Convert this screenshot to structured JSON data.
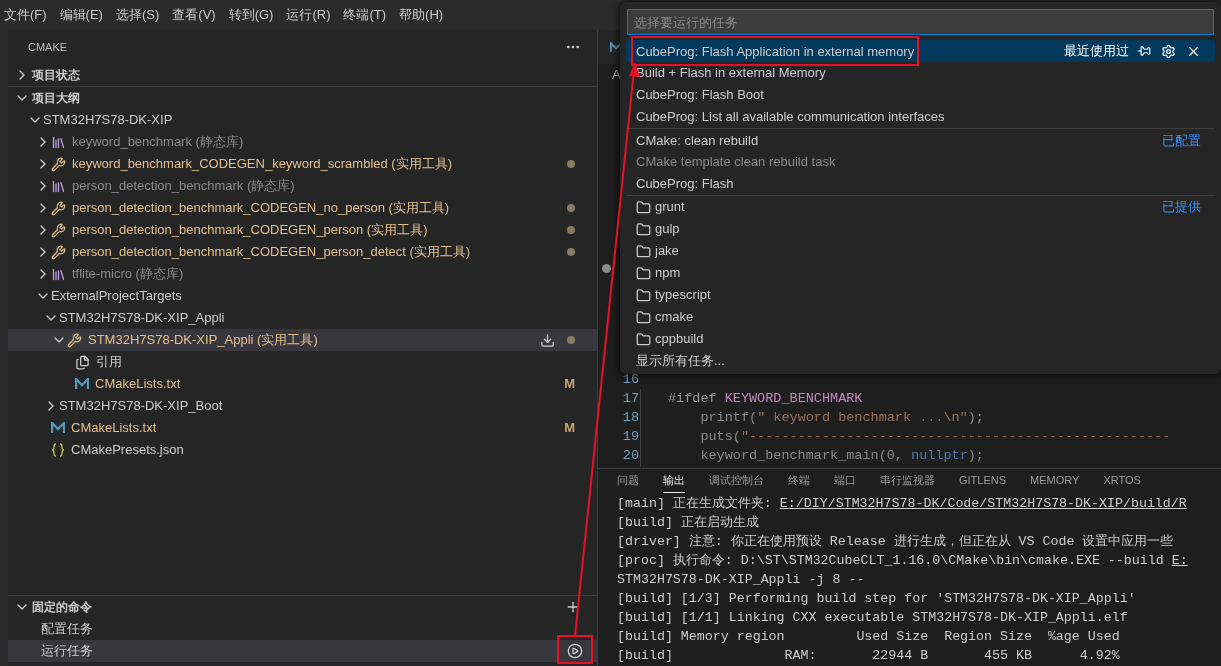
{
  "menu_bar": [
    "文件(F)",
    "编辑(E)",
    "选择(S)",
    "查看(V)",
    "转到(G)",
    "运行(R)",
    "终端(T)",
    "帮助(H)"
  ],
  "sidebar": {
    "title": "CMAKE",
    "sections": [
      {
        "label": "项目状态",
        "expanded": false
      },
      {
        "label": "项目大纲",
        "expanded": true,
        "tree": [
          {
            "label": "STM32H7S78-DK-XIP",
            "modified": false,
            "dimmed": false,
            "expanded": true,
            "selected": false,
            "children": [
              {
                "label": "keyword_benchmark (静态库)",
                "kind": "library",
                "modified": false,
                "dimmed": true,
                "expanded": false,
                "selected": false
              },
              {
                "label": "keyword_benchmark_CODEGEN_keyword_scrambled (实用工具)",
                "kind": "tool",
                "modified": true,
                "dimmed": false,
                "dot": true,
                "expanded": false,
                "selected": false
              },
              {
                "label": "person_detection_benchmark (静态库)",
                "kind": "library",
                "modified": false,
                "dimmed": true,
                "expanded": false,
                "selected": false
              },
              {
                "label": "person_detection_benchmark_CODEGEN_no_person (实用工具)",
                "kind": "tool",
                "modified": true,
                "dimmed": false,
                "dot": true,
                "expanded": false,
                "selected": false
              },
              {
                "label": "person_detection_benchmark_CODEGEN_person (实用工具)",
                "kind": "tool",
                "modified": true,
                "dimmed": false,
                "dot": true,
                "expanded": false,
                "selected": false
              },
              {
                "label": "person_detection_benchmark_CODEGEN_person_detect (实用工具)",
                "kind": "tool",
                "modified": true,
                "dimmed": false,
                "dot": true,
                "expanded": false,
                "selected": false
              },
              {
                "label": "tflite-micro (静态库)",
                "kind": "library",
                "modified": false,
                "dimmed": true,
                "expanded": false,
                "selected": false
              },
              {
                "label": "ExternalProjectTargets",
                "modified": false,
                "dimmed": false,
                "expanded": true,
                "selected": false,
                "children": [
                  {
                    "label": "STM32H7S78-DK-XIP_Appli",
                    "modified": false,
                    "dimmed": false,
                    "expanded": true,
                    "selected": false,
                    "children": [
                      {
                        "label": "STM32H7S78-DK-XIP_Appli (实用工具)",
                        "kind": "tool",
                        "modified": true,
                        "dimmed": false,
                        "dot": true,
                        "expanded": true,
                        "selected": true,
                        "children": [
                          {
                            "label": "引用",
                            "kind": "references",
                            "modified": false,
                            "dimmed": false,
                            "selected": false
                          },
                          {
                            "label": "CMakeLists.txt",
                            "kind": "cmake-file",
                            "modified": true,
                            "dimmed": false,
                            "badge": "M",
                            "selected": false
                          }
                        ]
                      }
                    ]
                  },
                  {
                    "label": "STM32H7S78-DK-XIP_Boot",
                    "modified": false,
                    "dimmed": false,
                    "expanded": false,
                    "selected": false
                  }
                ]
              },
              {
                "label": "CMakeLists.txt",
                "kind": "cmake-file",
                "modified": true,
                "dimmed": false,
                "badge": "M",
                "selected": false
              },
              {
                "label": "CMakePresets.json",
                "kind": "json-file",
                "modified": false,
                "dimmed": false,
                "selected": false
              }
            ]
          }
        ]
      }
    ],
    "pinned": {
      "label": "固定的命令",
      "expanded": true,
      "items": [
        {
          "label": "配置任务",
          "selected": false
        },
        {
          "label": "运行任务",
          "selected": true
        }
      ]
    }
  },
  "editor": {
    "breadcrumb": "A",
    "lines": [
      {
        "number": "16"
      },
      {
        "number": "17",
        "tokens": [
          {
            "kind": "directive",
            "text": "#ifdef "
          },
          {
            "kind": "macro",
            "text": "KEYWORD_BENCHMARK"
          }
        ]
      },
      {
        "number": "18",
        "tokens": [
          {
            "kind": "plain",
            "text": "    printf("
          },
          {
            "kind": "string",
            "text": "\" keyword benchmark ...\\n\""
          },
          {
            "kind": "plain",
            "text": ");"
          }
        ]
      },
      {
        "number": "19",
        "tokens": [
          {
            "kind": "plain",
            "text": "    puts("
          },
          {
            "kind": "string",
            "text": "\"----------------------------------------------------"
          }
        ]
      },
      {
        "number": "20",
        "tokens": [
          {
            "kind": "plain",
            "text": "    keyword_benchmark_main(0, "
          },
          {
            "kind": "keyword",
            "text": "nullptr"
          },
          {
            "kind": "plain",
            "text": ");"
          }
        ]
      }
    ]
  },
  "panel": {
    "tabs": [
      {
        "label": "问题",
        "selected": false
      },
      {
        "label": "输出",
        "selected": true
      },
      {
        "label": "调试控制台",
        "selected": false
      },
      {
        "label": "终端",
        "selected": false
      },
      {
        "label": "端口",
        "selected": false
      },
      {
        "label": "串行监视器",
        "selected": false
      },
      {
        "label": "GITLENS",
        "selected": false
      },
      {
        "label": "MEMORY",
        "selected": false
      },
      {
        "label": "XRTOS",
        "selected": false
      }
    ],
    "output": [
      [
        {
          "text": "[main] 正在生成文件夹: ",
          "link": false
        },
        {
          "text": "E:/DIY/STM32H7S78-DK/Code/STM32H7S78-DK-XIP/build/R",
          "link": true
        }
      ],
      [
        {
          "text": "[build] 正在启动生成",
          "link": false
        }
      ],
      [
        {
          "text": "[driver] 注意: 你正在使用预设 Release 进行生成，但正在从 VS Code 设置中应用一些",
          "link": false
        }
      ],
      [
        {
          "text": "[proc] 执行命令: D:\\ST\\STM32CubeCLT_1.16.0\\CMake\\bin\\cmake.EXE --build ",
          "link": false
        },
        {
          "text": "E:",
          "link": true
        }
      ],
      [
        {
          "text": "STM32H7S78-DK-XIP_Appli -j 8 --",
          "link": false
        }
      ],
      [
        {
          "text": "[build] [1/3] Performing build step for 'STM32H7S78-DK-XIP_Appli'",
          "link": false
        }
      ],
      [
        {
          "text": "[build] [1/1] Linking CXX executable STM32H7S78-DK-XIP_Appli.elf",
          "link": false
        }
      ],
      [
        {
          "text": "[build] Memory region         Used Size  Region Size  %age Used",
          "link": false
        }
      ],
      [
        {
          "text": "[build]              RAM:       22944 B       455 KB      4.92%",
          "link": false
        }
      ]
    ]
  },
  "quick_pick": {
    "placeholder": "选择要运行的任务",
    "groups": [
      {
        "label": "最近使用过",
        "items": [
          {
            "kind": "task",
            "label": "CubeProg: Flash Application in external memory",
            "selected": true
          },
          {
            "kind": "task",
            "label": "Build + Flash in external Memory",
            "selected": false
          },
          {
            "kind": "task",
            "label": "CubeProg: Flash Boot",
            "selected": false
          },
          {
            "kind": "task",
            "label": "CubeProg: List all available communication interfaces",
            "selected": false
          }
        ]
      },
      {
        "label": "已配置",
        "items": [
          {
            "kind": "task",
            "label": "CMake: clean rebuild",
            "detail": "CMake template clean rebuild task",
            "selected": false
          },
          {
            "kind": "task",
            "label": "CubeProg: Flash",
            "selected": false
          }
        ]
      },
      {
        "label": "已提供",
        "items": [
          {
            "kind": "folder",
            "label": "grunt",
            "selected": false
          },
          {
            "kind": "folder",
            "label": "gulp",
            "selected": false
          },
          {
            "kind": "folder",
            "label": "jake",
            "selected": false
          },
          {
            "kind": "folder",
            "label": "npm",
            "selected": false
          },
          {
            "kind": "folder",
            "label": "typescript",
            "selected": false
          },
          {
            "kind": "folder",
            "label": "cmake",
            "selected": false
          },
          {
            "kind": "folder",
            "label": "cppbuild",
            "selected": false
          },
          {
            "kind": "command",
            "label": "显示所有任务...",
            "selected": false
          }
        ]
      }
    ]
  }
}
